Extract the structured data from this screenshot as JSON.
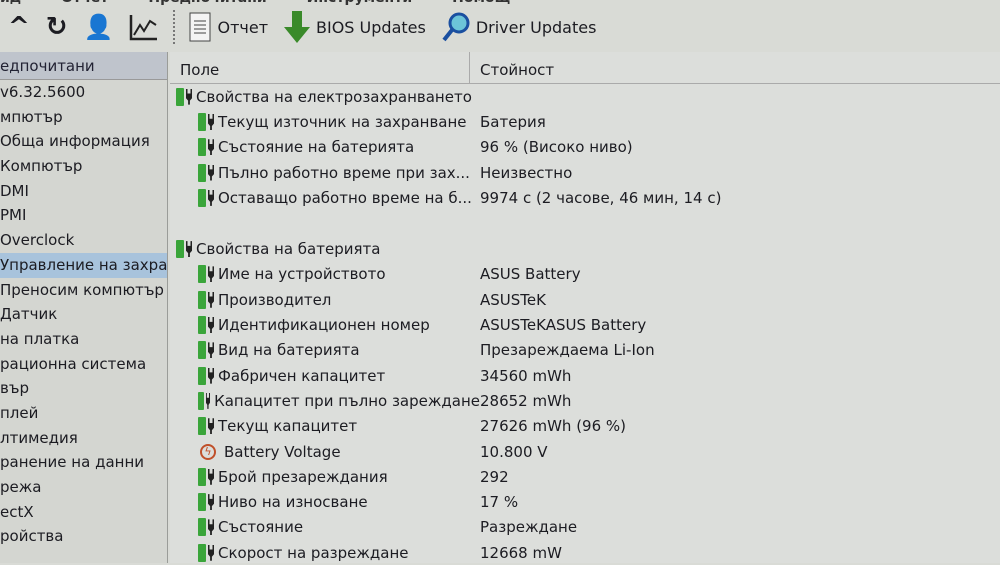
{
  "menu": [
    "ид",
    "Отчет",
    "Предпочитани",
    "Инструменти",
    "Помощ"
  ],
  "toolbar": {
    "report": "Отчет",
    "bios": "BIOS Updates",
    "driver": "Driver Updates"
  },
  "sidebar": {
    "header": "едпочитани",
    "items": [
      "v6.32.5600",
      "мпютър",
      "Обща информация",
      "Компютър",
      "DMI",
      "PMI",
      "Overclock",
      "Управление на захран",
      "Преносим компютър",
      "Датчик",
      "на платка",
      "рационна система",
      "вър",
      "плей",
      "лтимедия",
      "ранение на данни",
      "режа",
      "ectX",
      "ройства"
    ],
    "selected": 7
  },
  "columns": {
    "field": "Поле",
    "value": "Стойност"
  },
  "groups": [
    {
      "title": "Свойства на електрозахранването",
      "rows": [
        {
          "field": "Текущ източник на захранване",
          "value": "Батерия"
        },
        {
          "field": "Състояние на батерията",
          "value": "96 % (Високо ниво)"
        },
        {
          "field": "Пълно работно време при зах...",
          "value": "Неизвестно"
        },
        {
          "field": "Оставащо работно време на б...",
          "value": "9974 с (2 часове, 46 мин, 14 с)"
        }
      ]
    },
    {
      "title": "Свойства на батерията",
      "rows": [
        {
          "field": "Име на устройството",
          "value": "ASUS Battery"
        },
        {
          "field": "Производител",
          "value": "ASUSTeK"
        },
        {
          "field": "Идентификационен номер",
          "value": "ASUSTeKASUS Battery"
        },
        {
          "field": "Вид на батерията",
          "value": "Презареждаема Li-Ion"
        },
        {
          "field": "Фабричен капацитет",
          "value": "34560 mWh"
        },
        {
          "field": "Капацитет при пълно зареждане",
          "value": "28652 mWh"
        },
        {
          "field": "Текущ капацитет",
          "value": "27626 mWh  (96 %)"
        },
        {
          "field": "Battery Voltage",
          "value": "10.800 V",
          "icon": "voltage"
        },
        {
          "field": "Брой презареждания",
          "value": "292"
        },
        {
          "field": "Ниво на износване",
          "value": "17 %"
        },
        {
          "field": "Състояние",
          "value": "Разреждане"
        },
        {
          "field": "Скорост на разреждане",
          "value": "12668 mW"
        }
      ]
    }
  ]
}
